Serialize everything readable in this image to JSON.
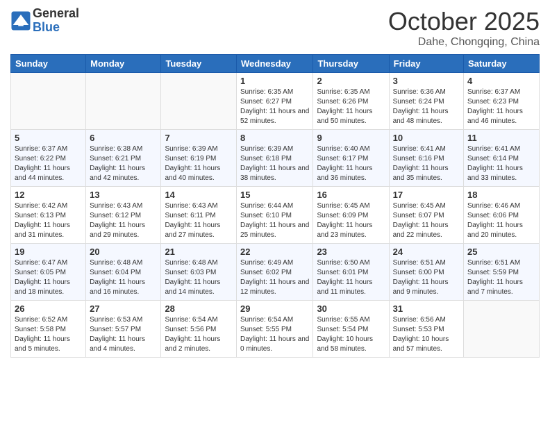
{
  "header": {
    "logo_general": "General",
    "logo_blue": "Blue",
    "month_title": "October 2025",
    "subtitle": "Dahe, Chongqing, China"
  },
  "weekdays": [
    "Sunday",
    "Monday",
    "Tuesday",
    "Wednesday",
    "Thursday",
    "Friday",
    "Saturday"
  ],
  "weeks": [
    [
      {
        "day": "",
        "sunrise": "",
        "sunset": "",
        "daylight": ""
      },
      {
        "day": "",
        "sunrise": "",
        "sunset": "",
        "daylight": ""
      },
      {
        "day": "",
        "sunrise": "",
        "sunset": "",
        "daylight": ""
      },
      {
        "day": "1",
        "sunrise": "Sunrise: 6:35 AM",
        "sunset": "Sunset: 6:27 PM",
        "daylight": "Daylight: 11 hours and 52 minutes."
      },
      {
        "day": "2",
        "sunrise": "Sunrise: 6:35 AM",
        "sunset": "Sunset: 6:26 PM",
        "daylight": "Daylight: 11 hours and 50 minutes."
      },
      {
        "day": "3",
        "sunrise": "Sunrise: 6:36 AM",
        "sunset": "Sunset: 6:24 PM",
        "daylight": "Daylight: 11 hours and 48 minutes."
      },
      {
        "day": "4",
        "sunrise": "Sunrise: 6:37 AM",
        "sunset": "Sunset: 6:23 PM",
        "daylight": "Daylight: 11 hours and 46 minutes."
      }
    ],
    [
      {
        "day": "5",
        "sunrise": "Sunrise: 6:37 AM",
        "sunset": "Sunset: 6:22 PM",
        "daylight": "Daylight: 11 hours and 44 minutes."
      },
      {
        "day": "6",
        "sunrise": "Sunrise: 6:38 AM",
        "sunset": "Sunset: 6:21 PM",
        "daylight": "Daylight: 11 hours and 42 minutes."
      },
      {
        "day": "7",
        "sunrise": "Sunrise: 6:39 AM",
        "sunset": "Sunset: 6:19 PM",
        "daylight": "Daylight: 11 hours and 40 minutes."
      },
      {
        "day": "8",
        "sunrise": "Sunrise: 6:39 AM",
        "sunset": "Sunset: 6:18 PM",
        "daylight": "Daylight: 11 hours and 38 minutes."
      },
      {
        "day": "9",
        "sunrise": "Sunrise: 6:40 AM",
        "sunset": "Sunset: 6:17 PM",
        "daylight": "Daylight: 11 hours and 36 minutes."
      },
      {
        "day": "10",
        "sunrise": "Sunrise: 6:41 AM",
        "sunset": "Sunset: 6:16 PM",
        "daylight": "Daylight: 11 hours and 35 minutes."
      },
      {
        "day": "11",
        "sunrise": "Sunrise: 6:41 AM",
        "sunset": "Sunset: 6:14 PM",
        "daylight": "Daylight: 11 hours and 33 minutes."
      }
    ],
    [
      {
        "day": "12",
        "sunrise": "Sunrise: 6:42 AM",
        "sunset": "Sunset: 6:13 PM",
        "daylight": "Daylight: 11 hours and 31 minutes."
      },
      {
        "day": "13",
        "sunrise": "Sunrise: 6:43 AM",
        "sunset": "Sunset: 6:12 PM",
        "daylight": "Daylight: 11 hours and 29 minutes."
      },
      {
        "day": "14",
        "sunrise": "Sunrise: 6:43 AM",
        "sunset": "Sunset: 6:11 PM",
        "daylight": "Daylight: 11 hours and 27 minutes."
      },
      {
        "day": "15",
        "sunrise": "Sunrise: 6:44 AM",
        "sunset": "Sunset: 6:10 PM",
        "daylight": "Daylight: 11 hours and 25 minutes."
      },
      {
        "day": "16",
        "sunrise": "Sunrise: 6:45 AM",
        "sunset": "Sunset: 6:09 PM",
        "daylight": "Daylight: 11 hours and 23 minutes."
      },
      {
        "day": "17",
        "sunrise": "Sunrise: 6:45 AM",
        "sunset": "Sunset: 6:07 PM",
        "daylight": "Daylight: 11 hours and 22 minutes."
      },
      {
        "day": "18",
        "sunrise": "Sunrise: 6:46 AM",
        "sunset": "Sunset: 6:06 PM",
        "daylight": "Daylight: 11 hours and 20 minutes."
      }
    ],
    [
      {
        "day": "19",
        "sunrise": "Sunrise: 6:47 AM",
        "sunset": "Sunset: 6:05 PM",
        "daylight": "Daylight: 11 hours and 18 minutes."
      },
      {
        "day": "20",
        "sunrise": "Sunrise: 6:48 AM",
        "sunset": "Sunset: 6:04 PM",
        "daylight": "Daylight: 11 hours and 16 minutes."
      },
      {
        "day": "21",
        "sunrise": "Sunrise: 6:48 AM",
        "sunset": "Sunset: 6:03 PM",
        "daylight": "Daylight: 11 hours and 14 minutes."
      },
      {
        "day": "22",
        "sunrise": "Sunrise: 6:49 AM",
        "sunset": "Sunset: 6:02 PM",
        "daylight": "Daylight: 11 hours and 12 minutes."
      },
      {
        "day": "23",
        "sunrise": "Sunrise: 6:50 AM",
        "sunset": "Sunset: 6:01 PM",
        "daylight": "Daylight: 11 hours and 11 minutes."
      },
      {
        "day": "24",
        "sunrise": "Sunrise: 6:51 AM",
        "sunset": "Sunset: 6:00 PM",
        "daylight": "Daylight: 11 hours and 9 minutes."
      },
      {
        "day": "25",
        "sunrise": "Sunrise: 6:51 AM",
        "sunset": "Sunset: 5:59 PM",
        "daylight": "Daylight: 11 hours and 7 minutes."
      }
    ],
    [
      {
        "day": "26",
        "sunrise": "Sunrise: 6:52 AM",
        "sunset": "Sunset: 5:58 PM",
        "daylight": "Daylight: 11 hours and 5 minutes."
      },
      {
        "day": "27",
        "sunrise": "Sunrise: 6:53 AM",
        "sunset": "Sunset: 5:57 PM",
        "daylight": "Daylight: 11 hours and 4 minutes."
      },
      {
        "day": "28",
        "sunrise": "Sunrise: 6:54 AM",
        "sunset": "Sunset: 5:56 PM",
        "daylight": "Daylight: 11 hours and 2 minutes."
      },
      {
        "day": "29",
        "sunrise": "Sunrise: 6:54 AM",
        "sunset": "Sunset: 5:55 PM",
        "daylight": "Daylight: 11 hours and 0 minutes."
      },
      {
        "day": "30",
        "sunrise": "Sunrise: 6:55 AM",
        "sunset": "Sunset: 5:54 PM",
        "daylight": "Daylight: 10 hours and 58 minutes."
      },
      {
        "day": "31",
        "sunrise": "Sunrise: 6:56 AM",
        "sunset": "Sunset: 5:53 PM",
        "daylight": "Daylight: 10 hours and 57 minutes."
      },
      {
        "day": "",
        "sunrise": "",
        "sunset": "",
        "daylight": ""
      }
    ]
  ]
}
